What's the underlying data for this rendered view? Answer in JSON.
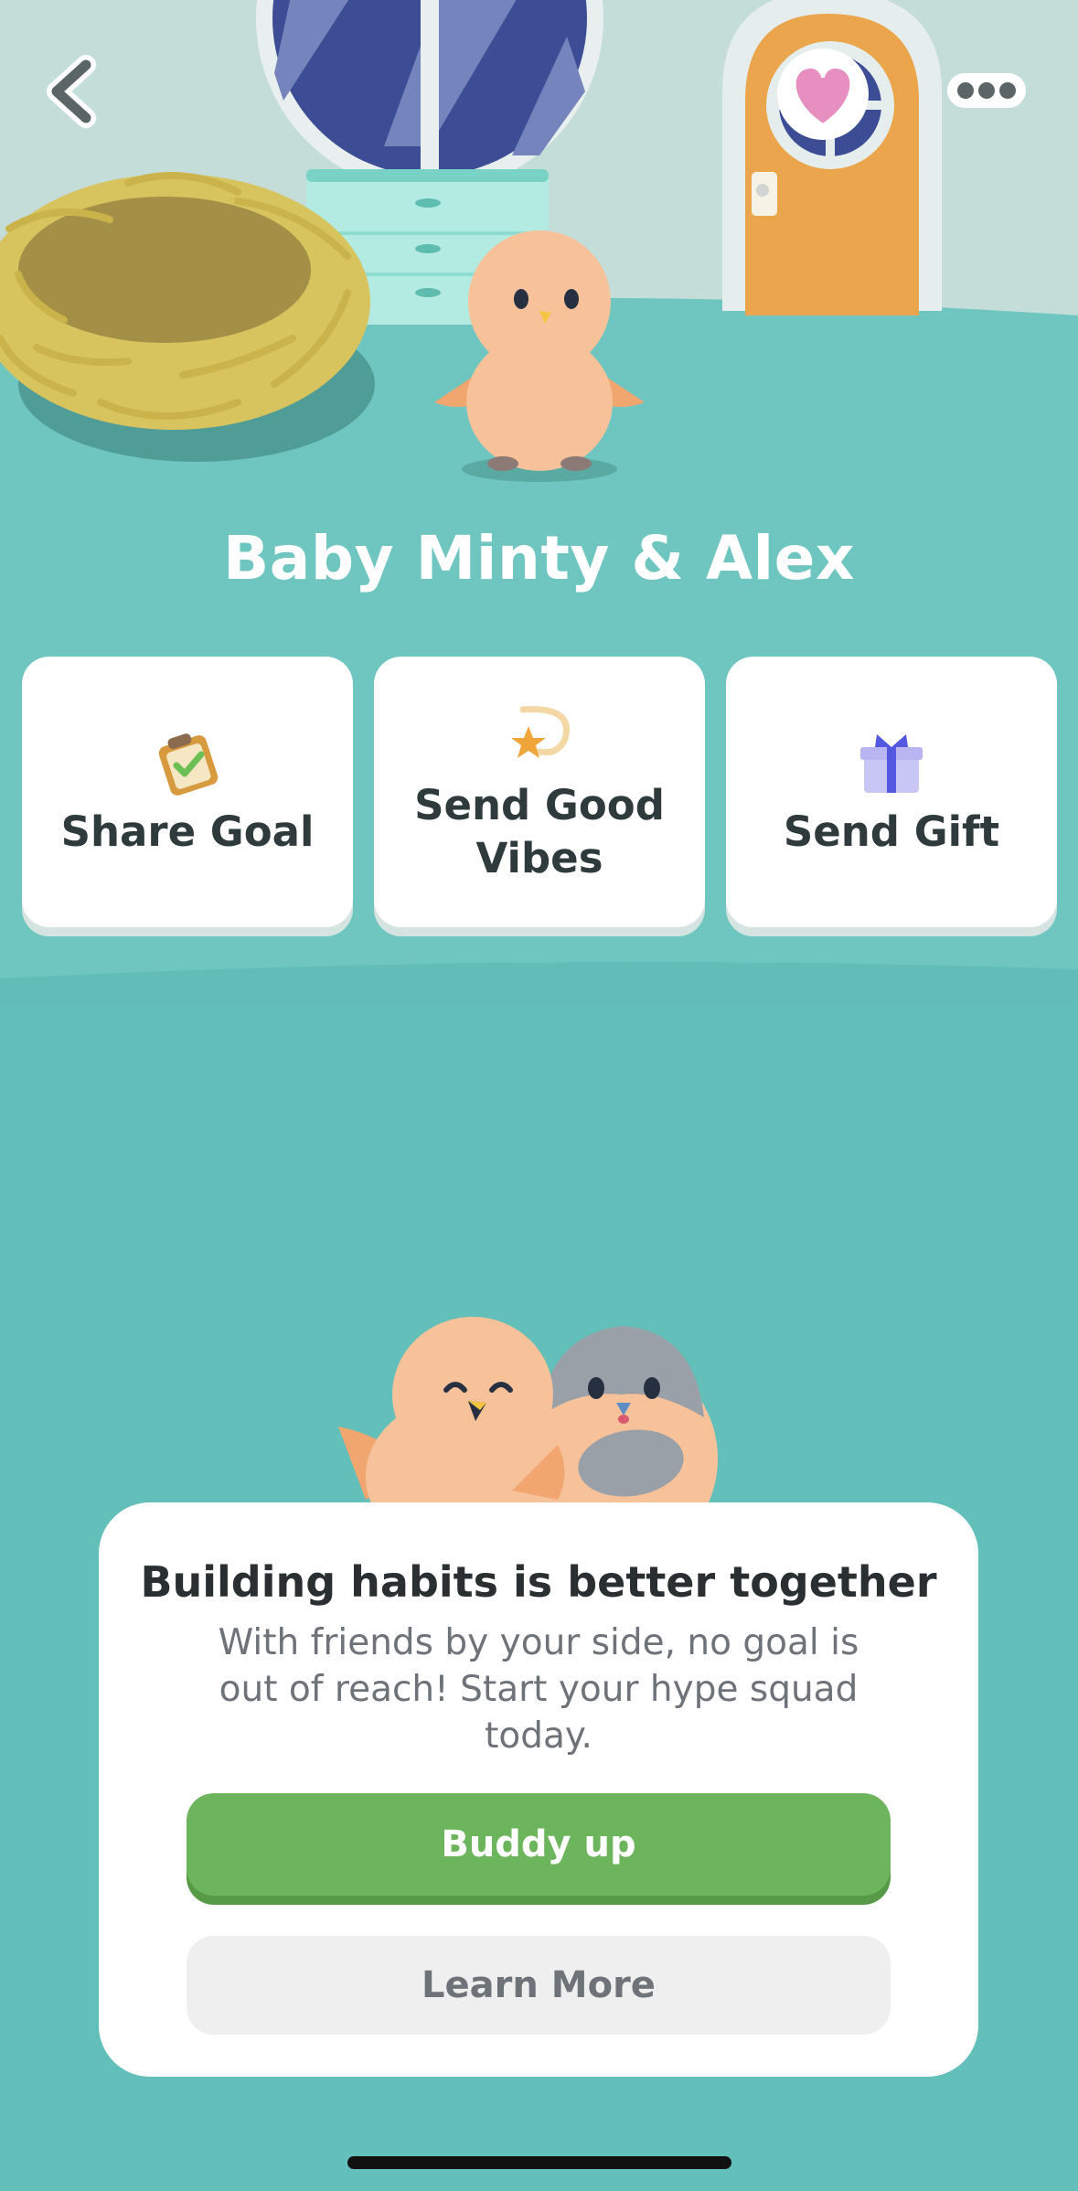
{
  "header": {
    "back_icon": "chevron-left-icon",
    "favorite_icon": "heart-icon",
    "more_icon": "more-dots-icon"
  },
  "hero": {
    "title": "Baby Minty & Alex"
  },
  "actions": [
    {
      "label": "Share Goal",
      "icon": "clipboard-check-icon"
    },
    {
      "label": "Send Good\nVibes",
      "icon": "shooting-star-icon"
    },
    {
      "label": "Send Gift",
      "icon": "gift-icon"
    }
  ],
  "promo": {
    "title": "Building habits is better together",
    "body": "With friends by your side, no goal is out of reach! Start your hype squad today.",
    "primary_label": "Buddy up",
    "secondary_label": "Learn More"
  },
  "colors": {
    "background": "#63bfb9",
    "wall": "#c5ddd9",
    "floor": "#6fc6c0",
    "primary_button": "#6db55d",
    "door": "#eaa54d",
    "heart": "#e88fc2"
  }
}
